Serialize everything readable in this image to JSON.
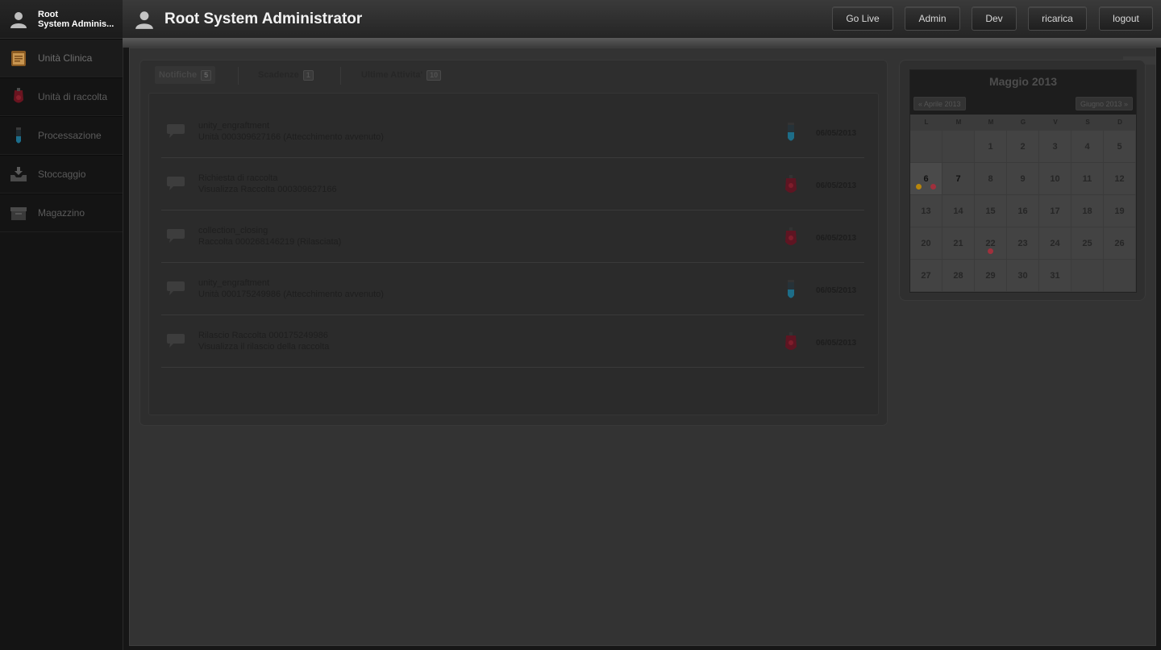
{
  "user": {
    "first": "Root",
    "full": "System Adminis..."
  },
  "sidebar": {
    "items": [
      {
        "label": "Unità Clinica",
        "icon": "clipboard-icon",
        "active": true
      },
      {
        "label": "Unità di raccolta",
        "icon": "blood-bag-icon",
        "active": false
      },
      {
        "label": "Processazione",
        "icon": "test-tube-icon",
        "active": false
      },
      {
        "label": "Stoccaggio",
        "icon": "inbox-download-icon",
        "active": false
      },
      {
        "label": "Magazzino",
        "icon": "archive-box-icon",
        "active": false
      }
    ]
  },
  "header": {
    "title": "Root System Administrator",
    "buttons": [
      "Go Live",
      "Admin",
      "Dev",
      "ricarica",
      "logout"
    ]
  },
  "tabs": [
    {
      "label": "Notifiche",
      "count": "5",
      "active": true
    },
    {
      "label": "Scadenze",
      "count": "1",
      "active": false
    },
    {
      "label": "Ultime Attivita'",
      "count": "10",
      "active": false
    }
  ],
  "notifications": [
    {
      "title": "unity_engraftment",
      "detail": "Unità 000309627166 (Attecchimento avvenuto)",
      "icon": "test-tube-icon",
      "date": "06/05/2013"
    },
    {
      "title": "Richiesta di raccolta",
      "detail": "Visualizza Raccolta 000309627166",
      "icon": "blood-bag-icon",
      "date": "06/05/2013"
    },
    {
      "title": "collection_closing",
      "detail": "Raccolta 000268146219 (Rilasciata)",
      "icon": "blood-bag-icon",
      "date": "06/05/2013"
    },
    {
      "title": "unity_engraftment",
      "detail": "Unità 000175249986 (Attecchimento avvenuto)",
      "icon": "test-tube-icon",
      "date": "06/05/2013"
    },
    {
      "title": "Rilascio Raccolta 000175249986",
      "detail": "Visualizza il rilascio della raccolta",
      "icon": "blood-bag-icon",
      "date": "06/05/2013"
    }
  ],
  "calendar": {
    "title": "Maggio 2013",
    "prev": "« Aprile 2013",
    "next": "Giugno 2013 »",
    "weekdays": [
      "L",
      "M",
      "M",
      "G",
      "V",
      "S",
      "D"
    ],
    "days": [
      "",
      "",
      "1",
      "2",
      "3",
      "4",
      "5",
      "6",
      "7",
      "8",
      "9",
      "10",
      "11",
      "12",
      "13",
      "14",
      "15",
      "16",
      "17",
      "18",
      "19",
      "20",
      "21",
      "22",
      "23",
      "24",
      "25",
      "26",
      "27",
      "28",
      "29",
      "30",
      "31",
      "",
      ""
    ],
    "today": "6",
    "highlight": "7",
    "event_dots": {
      "6": [
        "#b8860b",
        "#a0303c"
      ],
      "22": [
        "#a0303c"
      ]
    }
  }
}
